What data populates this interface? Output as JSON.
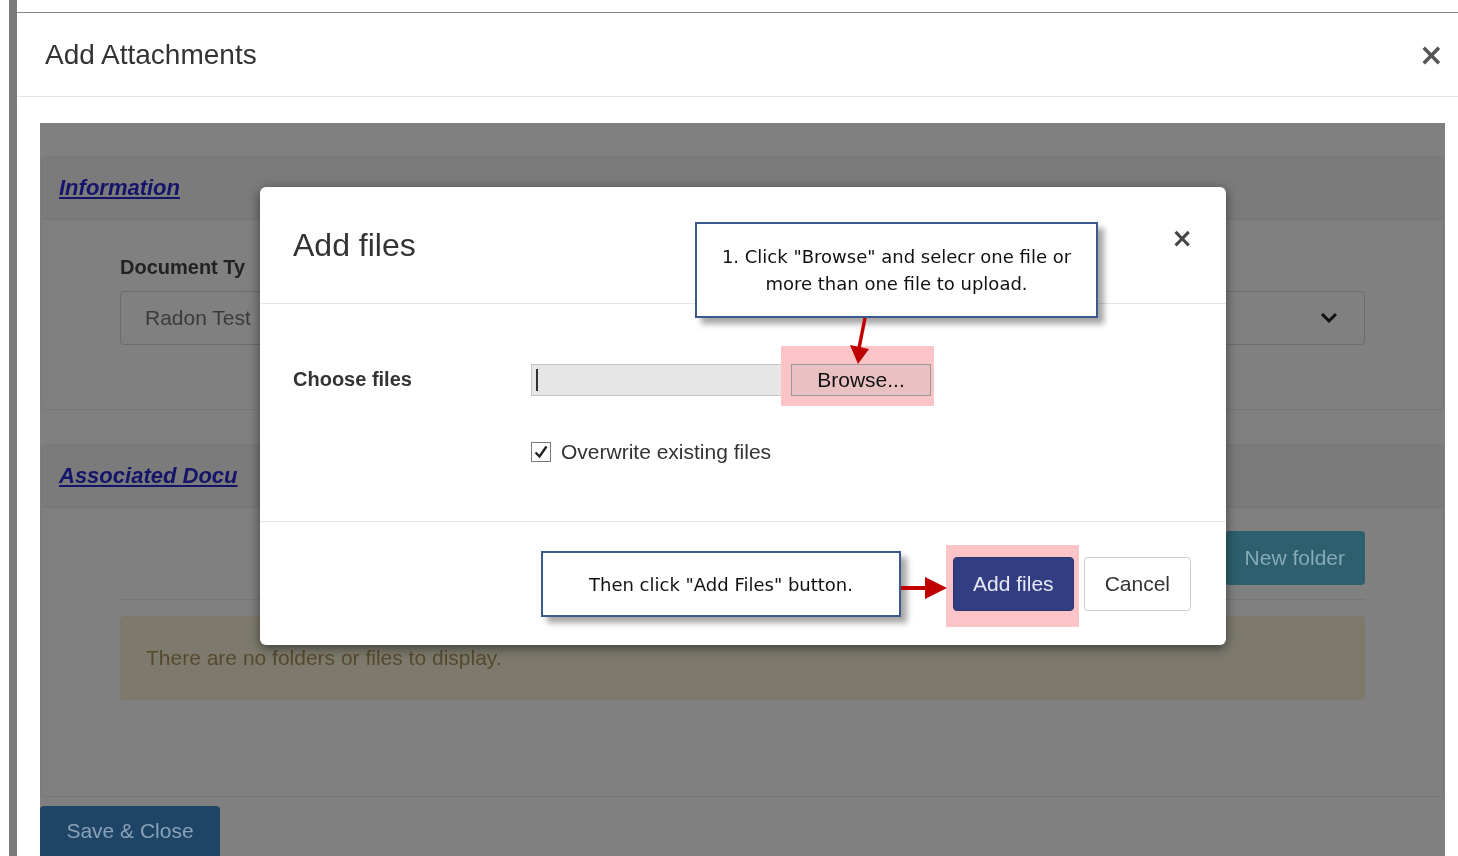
{
  "window": {
    "title": "Add Attachments",
    "close": "×"
  },
  "background": {
    "information": {
      "title": "Information",
      "document_type_label": "Document Ty",
      "document_type_value": "Radon Test"
    },
    "associated": {
      "title": "Associated Docu",
      "new_folder_button": "New folder",
      "empty_message": "There are no folders or files to display."
    },
    "save_button": "Save & Close"
  },
  "dialog": {
    "title": "Add files",
    "close": "×",
    "choose_label": "Choose files",
    "browse_button": "Browse...",
    "overwrite": {
      "label": "Overwrite existing files",
      "checked": true
    },
    "buttons": [
      {
        "label": "Add files",
        "kind": "primary",
        "highlighted": true
      },
      {
        "label": "Cancel",
        "kind": "default",
        "highlighted": false
      }
    ]
  },
  "callouts": [
    {
      "kind": "browse",
      "text": "1. Click \"Browse\" and selecr one file or more than one file to upload."
    },
    {
      "kind": "add",
      "text": "Then click \"Add Files\" button."
    }
  ]
}
